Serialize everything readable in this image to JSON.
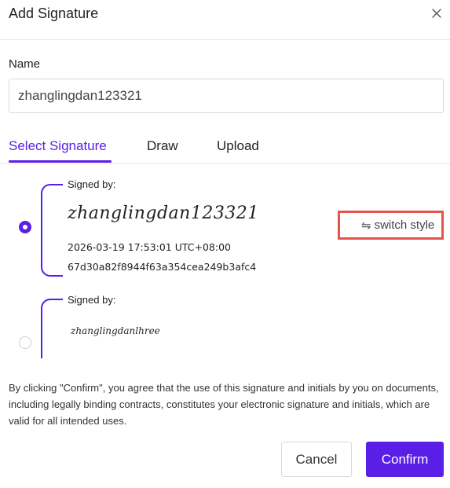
{
  "dialog": {
    "title": "Add Signature",
    "close_icon": "close-icon"
  },
  "name_field": {
    "label": "Name",
    "value": "zhanglingdan123321"
  },
  "tabs": [
    {
      "label": "Select Signature",
      "active": true
    },
    {
      "label": "Draw",
      "active": false
    },
    {
      "label": "Upload",
      "active": false
    }
  ],
  "signatures": [
    {
      "selected": true,
      "signed_by_label": "Signed by:",
      "signature_text": "zhanglingdan123321",
      "timestamp": "2026-03-19 17:53:01 UTC+08:00",
      "hash": "67d30a82f8944f63a354cea249b3afc4",
      "switch_style_label": "switch style",
      "switch_icon": "swap-arrows-icon"
    },
    {
      "selected": false,
      "signed_by_label": "Signed by:",
      "signature_text": "zhanglingdanlhree"
    }
  ],
  "disclaimer": "By clicking \"Confirm\", you agree that the use of this signature and initials by you on documents, including legally binding contracts, constitutes your electronic signature and initials, which are valid for all intended uses.",
  "buttons": {
    "cancel": "Cancel",
    "confirm": "Confirm"
  },
  "colors": {
    "accent": "#5b1ee6",
    "highlight_border": "#e5534b"
  }
}
